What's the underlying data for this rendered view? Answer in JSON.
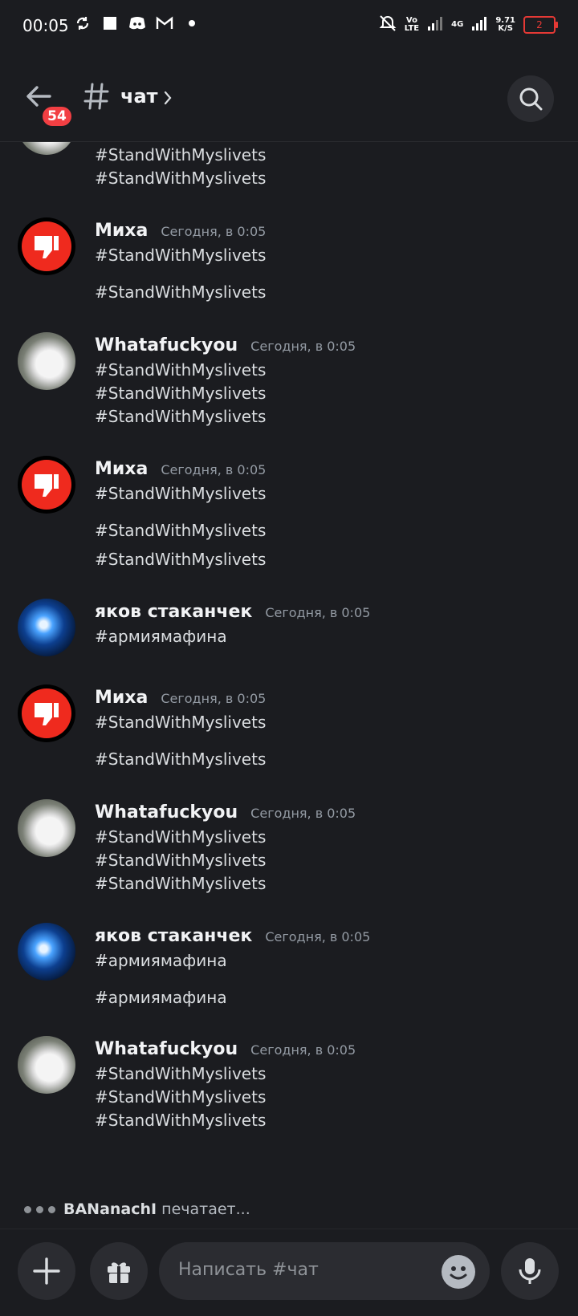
{
  "status_bar": {
    "time": "00:05",
    "volte_top": "Vo",
    "volte_bottom": "LTE",
    "net_4g": "4G",
    "speed_value": "9.71",
    "speed_unit": "K/S",
    "battery_level": "2",
    "battery_color": "#e53935"
  },
  "header": {
    "unread_badge": "54",
    "channel_name": "чат",
    "badge_color": "#f23f43"
  },
  "messages": [
    {
      "author": "",
      "time": "",
      "avatar": "cat-icon",
      "lines": [
        "#StandWithMyslivets",
        "#StandWithMyslivets"
      ]
    },
    {
      "author": "Миха",
      "time": "Сегодня, в 0:05",
      "avatar": "thumbs-down-icon",
      "lines": [
        "#StandWithMyslivets",
        "#StandWithMyslivets"
      ]
    },
    {
      "author": "Whatafuckyou",
      "time": "Сегодня, в 0:05",
      "avatar": "cat-icon",
      "lines": [
        "#StandWithMyslivets",
        "#StandWithMyslivets",
        "#StandWithMyslivets"
      ]
    },
    {
      "author": "Миха",
      "time": "Сегодня, в 0:05",
      "avatar": "thumbs-down-icon",
      "lines": [
        "#StandWithMyslivets",
        "#StandWithMyslivets",
        "#StandWithMyslivets"
      ]
    },
    {
      "author": "яков стаканчек",
      "time": "Сегодня, в 0:05",
      "avatar": "anime-icon",
      "lines": [
        "#армиямафина"
      ]
    },
    {
      "author": "Миха",
      "time": "Сегодня, в 0:05",
      "avatar": "thumbs-down-icon",
      "lines": [
        "#StandWithMyslivets",
        "#StandWithMyslivets"
      ]
    },
    {
      "author": "Whatafuckyou",
      "time": "Сегодня, в 0:05",
      "avatar": "cat-icon",
      "lines": [
        "#StandWithMyslivets",
        "#StandWithMyslivets",
        "#StandWithMyslivets"
      ]
    },
    {
      "author": "яков стаканчек",
      "time": "Сегодня, в 0:05",
      "avatar": "anime-icon",
      "lines": [
        "#армиямафина",
        "#армиямафина"
      ]
    },
    {
      "author": "Whatafuckyou",
      "time": "Сегодня, в 0:05",
      "avatar": "cat-icon",
      "lines": [
        "#StandWithMyslivets",
        "#StandWithMyslivets",
        "#StandWithMyslivets"
      ]
    }
  ],
  "typing": {
    "user": "BANanachI",
    "text": "печатает..."
  },
  "composer": {
    "placeholder": "Написать #чат"
  }
}
